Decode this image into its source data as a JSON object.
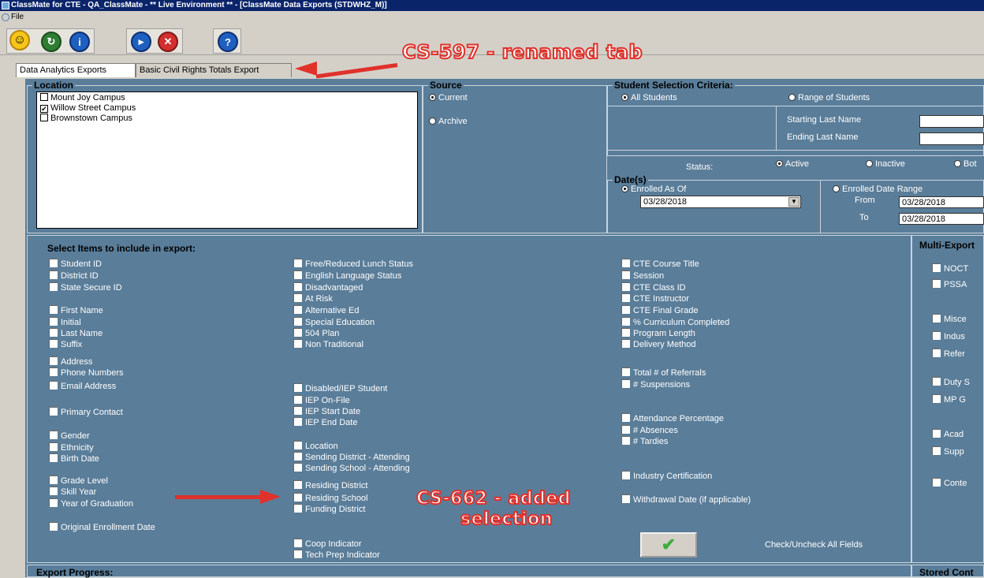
{
  "window": {
    "title": "ClassMate for CTE - QA_ClassMate - ** Live Environment ** - [ClassMate Data Exports (STDWHZ_M)]"
  },
  "menu": {
    "file": "File"
  },
  "tabs": [
    {
      "label": "Data Analytics Exports"
    },
    {
      "label": "Basic Civil Rights Totals Export"
    }
  ],
  "location": {
    "title": "Location",
    "items": [
      {
        "label": "Mount Joy Campus",
        "checked": false
      },
      {
        "label": "Willow Street Campus",
        "checked": true
      },
      {
        "label": "Brownstown Campus",
        "checked": false
      }
    ]
  },
  "source": {
    "title": "Source",
    "current": "Current",
    "archive": "Archive"
  },
  "criteria": {
    "title": "Student Selection Criteria:",
    "all": "All Students",
    "range": "Range of Students",
    "starting": "Starting Last Name",
    "ending": "Ending Last Name",
    "status_label": "Status:",
    "active": "Active",
    "inactive": "Inactive",
    "both": "Bot"
  },
  "dates": {
    "title": "Date(s)",
    "enrolled_as_of": "Enrolled As Of",
    "enrolled_as_of_value": "03/28/2018",
    "range": "Enrolled Date Range",
    "from": "From",
    "from_value": "03/28/2018",
    "to": "To",
    "to_value": "03/28/2018"
  },
  "items": {
    "heading": "Select Items to include in export:",
    "col1": [
      "Student ID",
      "District ID",
      "State Secure ID",
      "First Name",
      "Initial",
      "Last Name",
      "Suffix",
      "Address",
      "Phone Numbers",
      "Email Address",
      "Primary Contact",
      "Gender",
      "Ethnicity",
      "Birth Date",
      "Grade Level",
      "Skill Year",
      "Year of Graduation",
      "Original Enrollment Date"
    ],
    "col2": [
      "Free/Reduced Lunch Status",
      "English Language Status",
      "Disadvantaged",
      "At Risk",
      "Alternative Ed",
      "Special Education",
      "504 Plan",
      "Non Traditional",
      "Disabled/IEP Student",
      "IEP On-File",
      "IEP Start Date",
      "IEP End Date",
      "Location",
      "Sending District - Attending",
      "Sending School - Attending",
      "Residing District",
      "Residing School",
      "Funding District",
      "Coop Indicator",
      "Tech Prep Indicator"
    ],
    "col3": [
      "CTE Course Title",
      "Session",
      "CTE Class ID",
      "CTE Instructor",
      "CTE Final Grade",
      "% Curriculum Completed",
      "Program Length",
      "Delivery Method",
      "Total # of Referrals",
      "# Suspensions",
      "Attendance Percentage",
      "# Absences",
      "# Tardies",
      "Industry Certification",
      "Withdrawal Date (if applicable)"
    ],
    "check_all": "Check/Uncheck All Fields"
  },
  "multi": {
    "heading": "Multi-Export",
    "items": [
      "NOCT",
      "PSSA",
      "Misce",
      "Indus",
      "Refer",
      "Duty S",
      "MP G",
      "Acad",
      "Supp",
      "Conte"
    ]
  },
  "footer": {
    "progress": "Export Progress:",
    "stored": "Stored Cont"
  },
  "annotations": {
    "tab_note": "CS-597 - renamed tab",
    "sel_note_1": "CS-662 - added",
    "sel_note_2": "selection"
  }
}
